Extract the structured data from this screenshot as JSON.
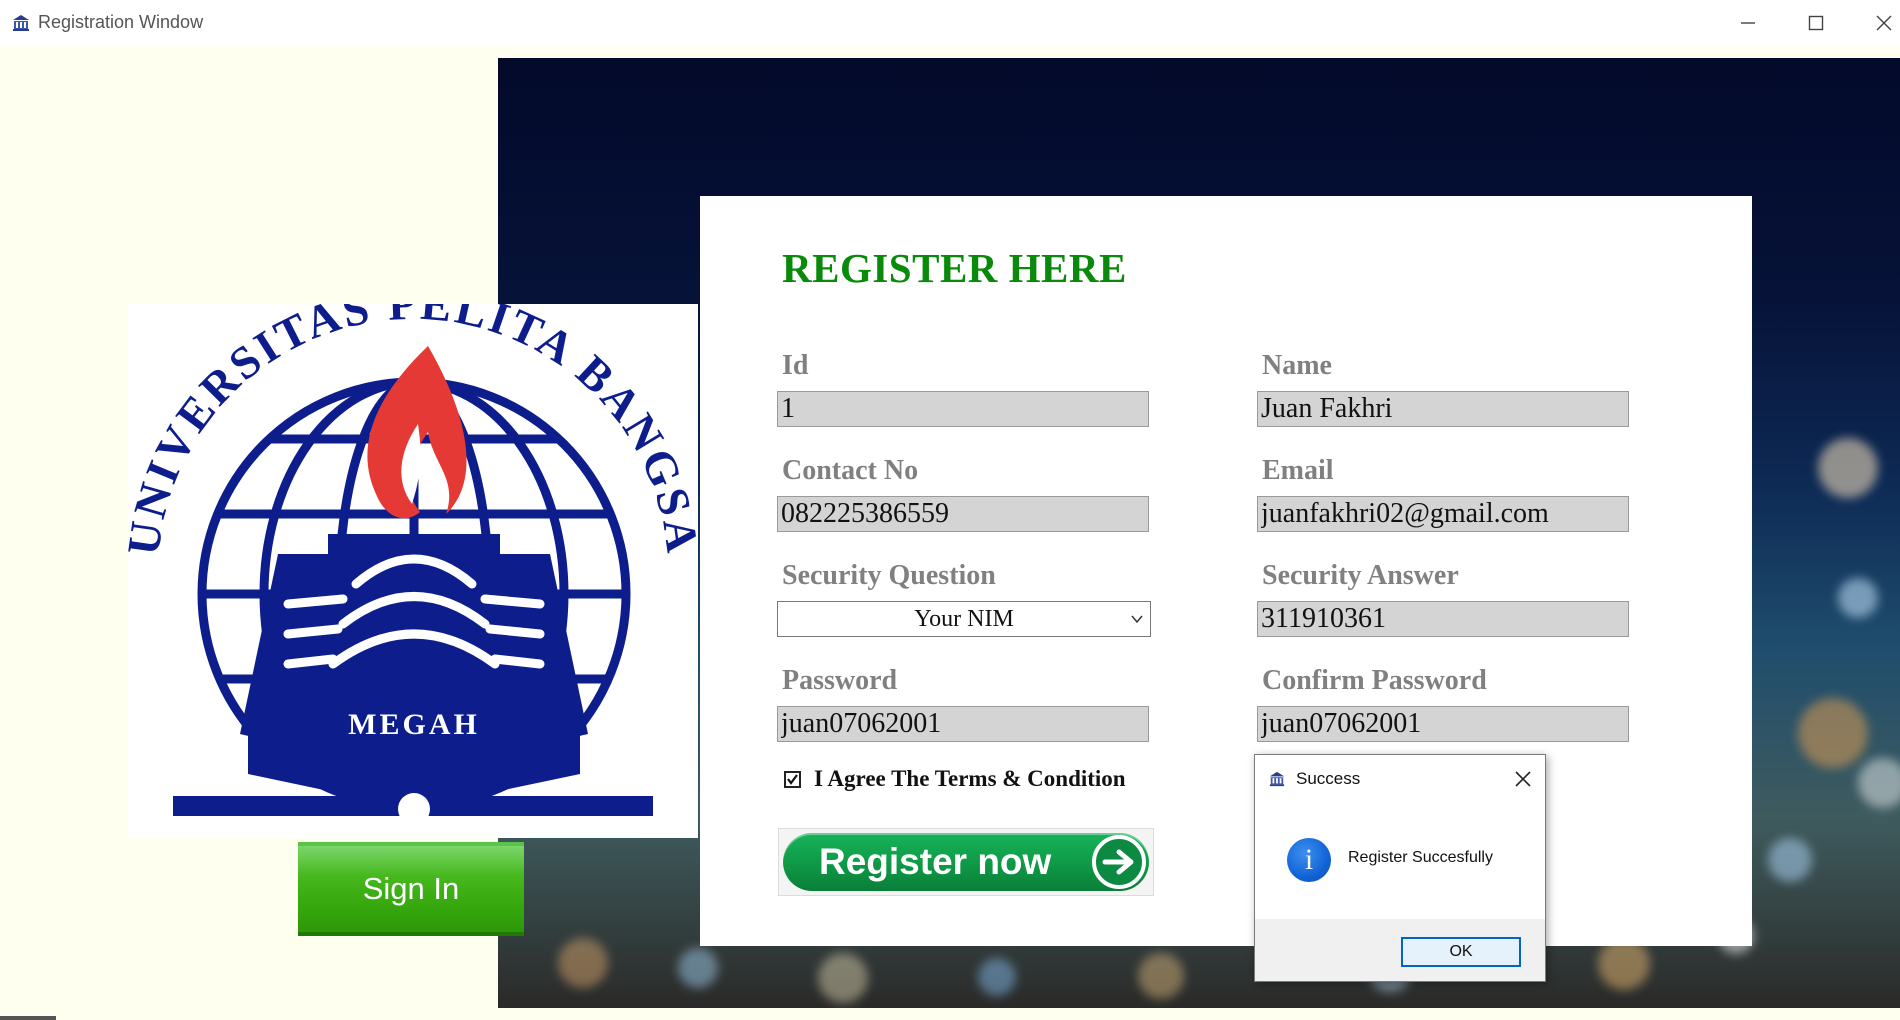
{
  "window": {
    "title": "Registration Window",
    "app_icon": "university-icon",
    "controls": [
      "minimize-icon",
      "maximize-icon",
      "close-icon"
    ]
  },
  "logo": {
    "arc_text": "UNIVERSITAS PELITA BANGSA",
    "motto": "MEGAH",
    "colors": {
      "navy": "#0d1e8c",
      "flame": "#e53935"
    }
  },
  "signin": {
    "label": "Sign In"
  },
  "form": {
    "heading": "REGISTER HERE",
    "fields": {
      "id": {
        "label": "Id",
        "value": "1"
      },
      "name": {
        "label": "Name",
        "value": "Juan Fakhri"
      },
      "contact": {
        "label": "Contact No",
        "value": "082225386559"
      },
      "email": {
        "label": "Email",
        "value": "juanfakhri02@gmail.com"
      },
      "security_question": {
        "label": "Security Question",
        "value": "Your NIM"
      },
      "security_answer": {
        "label": "Security Answer",
        "value": "311910361"
      },
      "password": {
        "label": "Password",
        "value": "juan07062001"
      },
      "confirm_password": {
        "label": "Confirm Password",
        "value": "juan07062001"
      }
    },
    "agree": {
      "label": "I Agree The Terms & Condition",
      "checked": true
    },
    "register_button": "Register now"
  },
  "dialog": {
    "title": "Success",
    "message": "Register Succesfully",
    "ok": "OK",
    "icon": "info-icon"
  },
  "colors": {
    "heading": "#0a8a0a",
    "field_bg": "#d4d4d4",
    "label": "#808080",
    "page_bg": "#fffff0"
  }
}
